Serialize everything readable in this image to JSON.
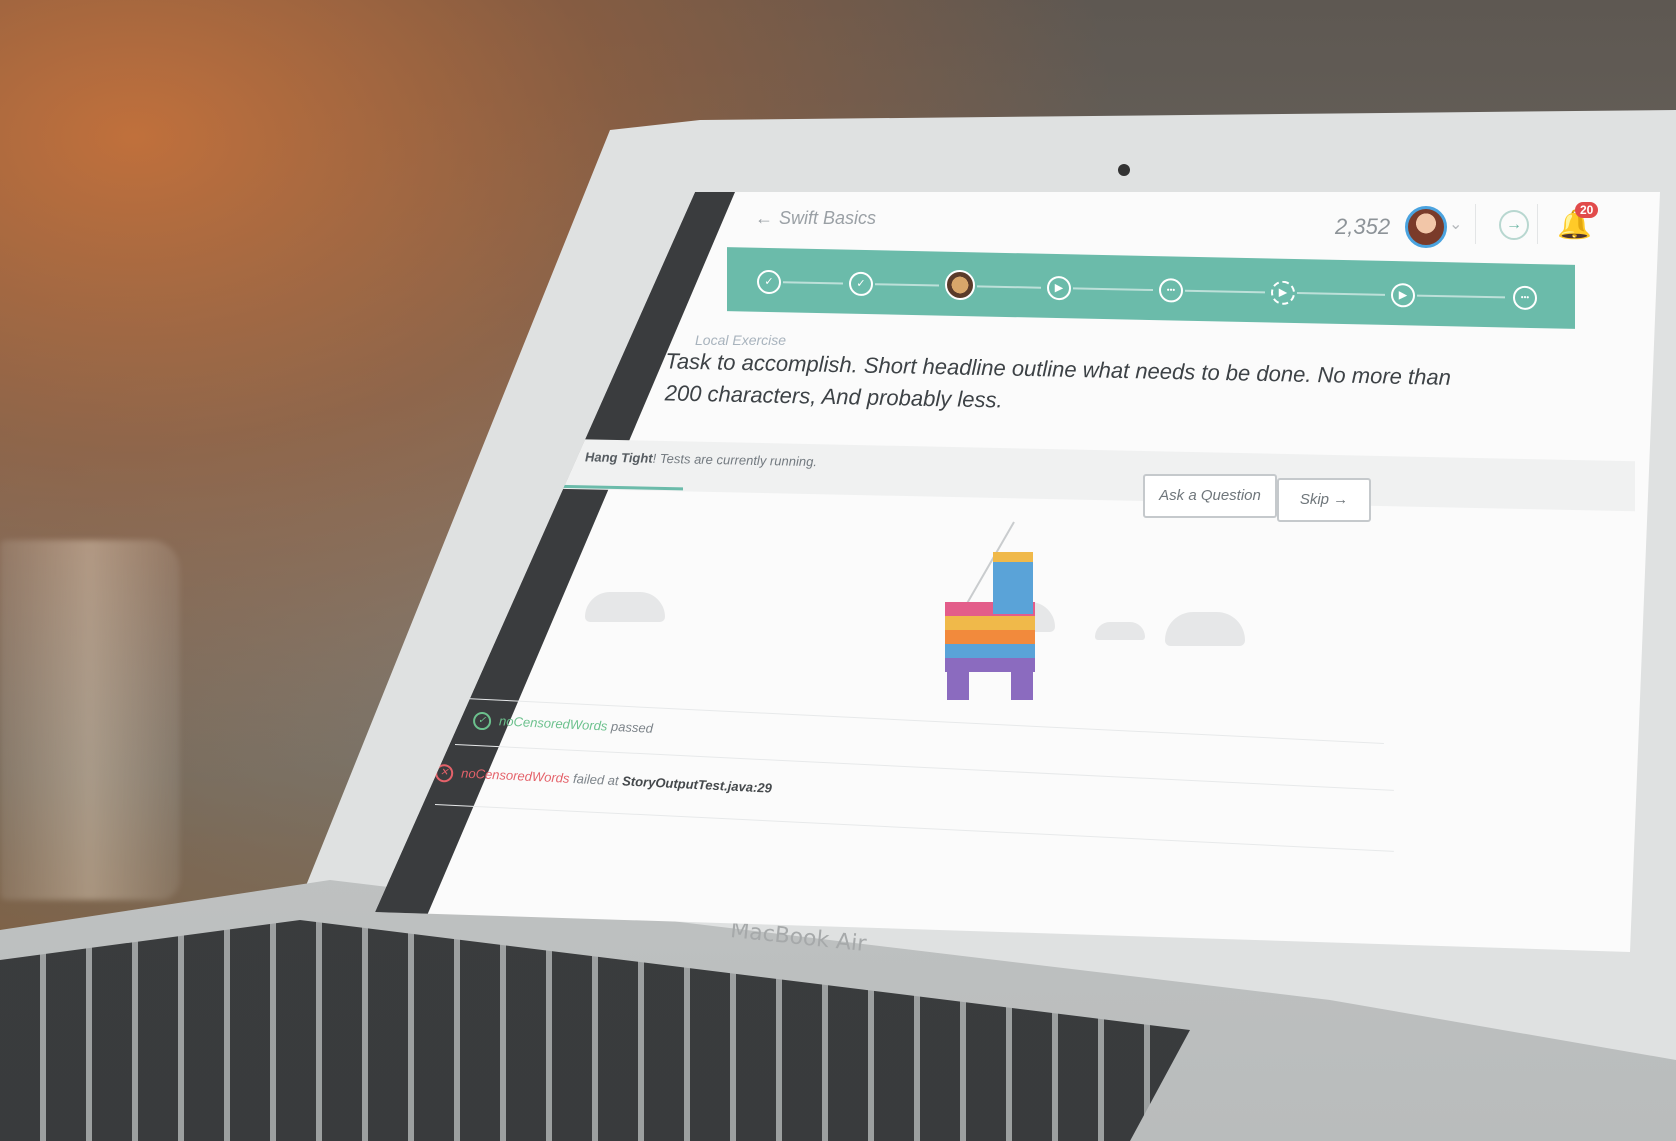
{
  "device": {
    "brand": "MacBook Air"
  },
  "header": {
    "back_label": "Swift Basics",
    "points": "2,352",
    "notifications_count": "20"
  },
  "progress": {
    "steps": [
      {
        "type": "done",
        "icon": "✓"
      },
      {
        "type": "done",
        "icon": "✓"
      },
      {
        "type": "current",
        "icon": ""
      },
      {
        "type": "video",
        "icon": "▶"
      },
      {
        "type": "quiz",
        "icon": "•••"
      },
      {
        "type": "video-locked",
        "icon": "▶"
      },
      {
        "type": "video",
        "icon": "▶"
      },
      {
        "type": "quiz",
        "icon": "•••"
      }
    ],
    "color": "#6bbbaa"
  },
  "exercise": {
    "type_label": "Local Exercise",
    "headline": "Task to accomplish. Short headline outline what needs to be done. No more than 200 characters, And probably less."
  },
  "status": {
    "strong": "Hang Tight",
    "text": "! Tests are currently running."
  },
  "buttons": {
    "ask": "Ask a Question",
    "skip": "Skip"
  },
  "tests": [
    {
      "name": "noCensoredWords",
      "result": "passed",
      "state": "pass"
    },
    {
      "name": "noCensoredWords",
      "result": "failed at",
      "file": "StoryOutputTest.java:29",
      "state": "fail"
    }
  ]
}
